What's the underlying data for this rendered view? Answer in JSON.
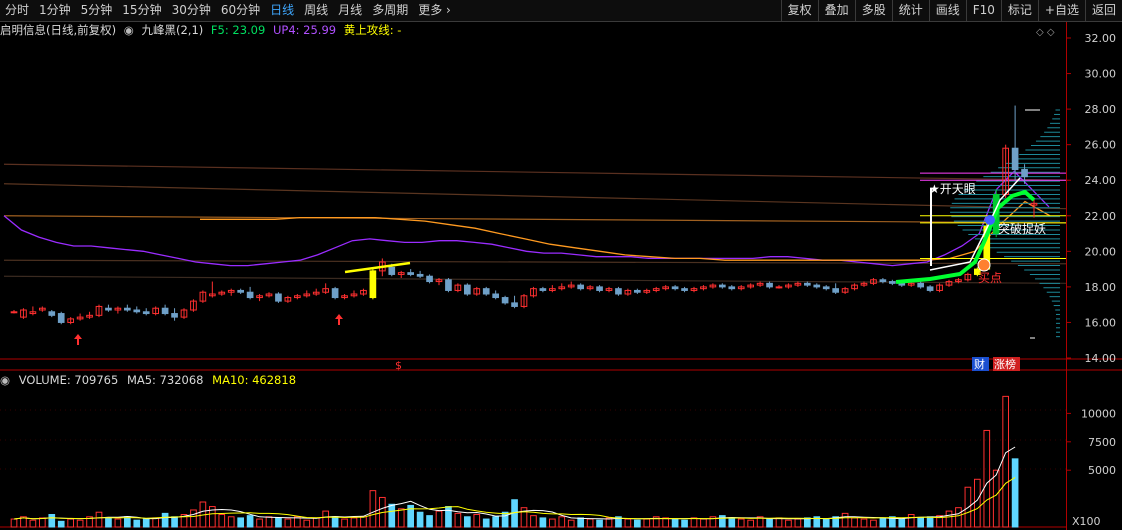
{
  "toolbar": {
    "timeframes": [
      "分时",
      "1分钟",
      "5分钟",
      "15分钟",
      "30分钟",
      "60分钟",
      "日线",
      "周线",
      "月线",
      "多周期",
      "更多"
    ],
    "active_timeframe": "日线",
    "buttons": [
      "复权",
      "叠加",
      "多股",
      "统计",
      "画线",
      "F10",
      "标记",
      "+自选",
      "返回"
    ]
  },
  "chart_info": {
    "stock": "启明信息(日线,前复权)",
    "indicator": "九峰黑(2,1)",
    "f5": "F5: 23.09",
    "up4": "UP4: 25.99",
    "huang": "黄上攻线: -"
  },
  "annotations": {
    "kaitianyan": "★开天眼",
    "tupo": "突破捉妖",
    "maidian": "买点",
    "dollar": "$",
    "cai": "财",
    "zhangbang": "涨榜"
  },
  "colors": {
    "up": "#ff3030",
    "down": "#5fd7ff",
    "yellow": "#ffff00",
    "green": "#00ff30",
    "purple": "#9a2cff",
    "orange": "#ff9a20",
    "white": "#ffffff"
  },
  "chart_data": [
    {
      "type": "candlestick",
      "title": "启明信息(日线,前复权)",
      "y_ticks": [
        "32.00",
        "30.00",
        "28.00",
        "26.00",
        "24.00",
        "22.00",
        "20.00",
        "18.00",
        "16.00",
        "14.00"
      ],
      "ylim": [
        14,
        32.5
      ],
      "candles": [
        [
          16.6,
          16.7,
          16.5,
          16.6
        ],
        [
          16.3,
          16.8,
          16.2,
          16.7
        ],
        [
          16.5,
          16.9,
          16.4,
          16.6
        ],
        [
          16.7,
          16.9,
          16.6,
          16.8
        ],
        [
          16.6,
          16.7,
          16.3,
          16.4
        ],
        [
          16.5,
          16.6,
          15.9,
          16.0
        ],
        [
          16.0,
          16.3,
          15.9,
          16.2
        ],
        [
          16.2,
          16.5,
          16.1,
          16.3
        ],
        [
          16.3,
          16.6,
          16.2,
          16.4
        ],
        [
          16.4,
          17.0,
          16.3,
          16.9
        ],
        [
          16.8,
          17.0,
          16.6,
          16.7
        ],
        [
          16.7,
          16.9,
          16.5,
          16.8
        ],
        [
          16.8,
          17.0,
          16.6,
          16.7
        ],
        [
          16.7,
          16.9,
          16.5,
          16.6
        ],
        [
          16.6,
          16.8,
          16.4,
          16.5
        ],
        [
          16.5,
          16.9,
          16.4,
          16.8
        ],
        [
          16.8,
          17.0,
          16.4,
          16.5
        ],
        [
          16.5,
          16.8,
          16.1,
          16.3
        ],
        [
          16.3,
          16.8,
          16.2,
          16.7
        ],
        [
          16.7,
          17.3,
          16.6,
          17.2
        ],
        [
          17.2,
          17.8,
          17.1,
          17.7
        ],
        [
          17.5,
          18.3,
          17.4,
          17.6
        ],
        [
          17.6,
          17.8,
          17.5,
          17.7
        ],
        [
          17.7,
          17.9,
          17.5,
          17.8
        ],
        [
          17.8,
          17.9,
          17.6,
          17.7
        ],
        [
          17.7,
          18.0,
          17.3,
          17.4
        ],
        [
          17.4,
          17.6,
          17.2,
          17.5
        ],
        [
          17.5,
          17.7,
          17.4,
          17.6
        ],
        [
          17.6,
          17.7,
          17.1,
          17.2
        ],
        [
          17.2,
          17.5,
          17.1,
          17.4
        ],
        [
          17.4,
          17.6,
          17.3,
          17.5
        ],
        [
          17.5,
          17.8,
          17.4,
          17.6
        ],
        [
          17.6,
          17.9,
          17.5,
          17.7
        ],
        [
          17.7,
          18.2,
          17.6,
          17.9
        ],
        [
          17.9,
          18.0,
          17.3,
          17.4
        ],
        [
          17.4,
          17.6,
          17.3,
          17.5
        ],
        [
          17.5,
          17.8,
          17.4,
          17.6
        ],
        [
          17.6,
          17.9,
          17.5,
          17.8
        ],
        [
          17.4,
          19.0,
          17.3,
          18.9
        ],
        [
          18.9,
          19.6,
          18.6,
          19.4
        ],
        [
          19.1,
          19.3,
          18.6,
          18.7
        ],
        [
          18.7,
          18.9,
          18.5,
          18.8
        ],
        [
          18.8,
          19.0,
          18.6,
          18.7
        ],
        [
          18.7,
          18.9,
          18.5,
          18.6
        ],
        [
          18.6,
          18.7,
          18.2,
          18.3
        ],
        [
          18.3,
          18.5,
          18.1,
          18.4
        ],
        [
          18.4,
          18.5,
          17.7,
          17.8
        ],
        [
          17.8,
          18.2,
          17.7,
          18.1
        ],
        [
          18.1,
          18.2,
          17.5,
          17.6
        ],
        [
          17.6,
          18.0,
          17.5,
          17.9
        ],
        [
          17.9,
          18.0,
          17.5,
          17.6
        ],
        [
          17.6,
          17.8,
          17.3,
          17.4
        ],
        [
          17.4,
          17.5,
          17.0,
          17.1
        ],
        [
          17.1,
          17.5,
          16.8,
          16.9
        ],
        [
          16.9,
          17.6,
          16.8,
          17.5
        ],
        [
          17.5,
          18.0,
          17.4,
          17.9
        ],
        [
          17.9,
          18.0,
          17.7,
          17.8
        ],
        [
          17.8,
          18.1,
          17.7,
          17.9
        ],
        [
          17.9,
          18.2,
          17.8,
          18.0
        ],
        [
          18.0,
          18.3,
          17.9,
          18.1
        ],
        [
          18.1,
          18.2,
          17.8,
          17.9
        ],
        [
          17.9,
          18.1,
          17.8,
          18.0
        ],
        [
          18.0,
          18.1,
          17.7,
          17.8
        ],
        [
          17.8,
          18.0,
          17.7,
          17.9
        ],
        [
          17.9,
          18.0,
          17.5,
          17.6
        ],
        [
          17.6,
          17.9,
          17.5,
          17.8
        ],
        [
          17.8,
          17.9,
          17.6,
          17.7
        ],
        [
          17.7,
          17.9,
          17.6,
          17.8
        ],
        [
          17.8,
          18.0,
          17.7,
          17.9
        ],
        [
          17.9,
          18.1,
          17.8,
          18.0
        ],
        [
          18.0,
          18.1,
          17.8,
          17.9
        ],
        [
          17.9,
          18.0,
          17.7,
          17.8
        ],
        [
          17.8,
          18.0,
          17.7,
          17.9
        ],
        [
          17.9,
          18.1,
          17.8,
          18.0
        ],
        [
          18.0,
          18.2,
          17.9,
          18.1
        ],
        [
          18.1,
          18.2,
          17.9,
          18.0
        ],
        [
          18.0,
          18.1,
          17.8,
          17.9
        ],
        [
          17.9,
          18.1,
          17.8,
          18.0
        ],
        [
          18.0,
          18.2,
          17.9,
          18.1
        ],
        [
          18.1,
          18.3,
          18.0,
          18.2
        ],
        [
          18.2,
          18.3,
          17.9,
          18.0
        ],
        [
          18.0,
          18.1,
          17.9,
          18.0
        ],
        [
          18.0,
          18.2,
          17.9,
          18.1
        ],
        [
          18.1,
          18.3,
          18.0,
          18.2
        ],
        [
          18.2,
          18.3,
          18.0,
          18.1
        ],
        [
          18.1,
          18.2,
          17.9,
          18.0
        ],
        [
          18.0,
          18.1,
          17.8,
          17.9
        ],
        [
          17.9,
          18.2,
          17.6,
          17.7
        ],
        [
          17.7,
          18.0,
          17.6,
          17.9
        ],
        [
          17.9,
          18.2,
          17.8,
          18.1
        ],
        [
          18.1,
          18.3,
          18.0,
          18.2
        ],
        [
          18.2,
          18.5,
          18.1,
          18.4
        ],
        [
          18.4,
          18.5,
          18.2,
          18.3
        ],
        [
          18.3,
          18.4,
          18.1,
          18.2
        ],
        [
          18.2,
          18.3,
          18.0,
          18.1
        ],
        [
          18.1,
          18.3,
          18.0,
          18.2
        ],
        [
          18.2,
          18.4,
          17.9,
          18.0
        ],
        [
          18.0,
          18.1,
          17.7,
          17.8
        ],
        [
          17.8,
          18.2,
          17.7,
          18.1
        ],
        [
          18.1,
          18.4,
          18.0,
          18.3
        ],
        [
          18.3,
          18.5,
          18.2,
          18.4
        ],
        [
          18.4,
          18.8,
          18.3,
          18.7
        ],
        [
          18.7,
          19.1,
          18.6,
          19.0
        ],
        [
          19.0,
          21.6,
          18.9,
          21.4
        ],
        [
          21.0,
          23.5,
          20.8,
          23.2
        ],
        [
          23.2,
          26.0,
          23.0,
          25.8
        ],
        [
          25.8,
          28.2,
          24.0,
          24.6
        ],
        [
          24.6,
          24.9,
          23.8,
          24.2
        ],
        [
          22.6,
          23.0,
          21.9,
          22.7
        ]
      ],
      "lines": [
        "九峰黑",
        "F5",
        "UP4",
        "黄上攻线"
      ]
    },
    {
      "type": "bar",
      "title": "VOLUME",
      "volume": "VOLUME: 709765",
      "ma5": "MA5: 732068",
      "ma10": "MA10: 462818",
      "y_ticks": [
        "10000",
        "7500",
        "5000"
      ],
      "unit": "X100",
      "ylim": [
        0,
        12500
      ]
    }
  ]
}
